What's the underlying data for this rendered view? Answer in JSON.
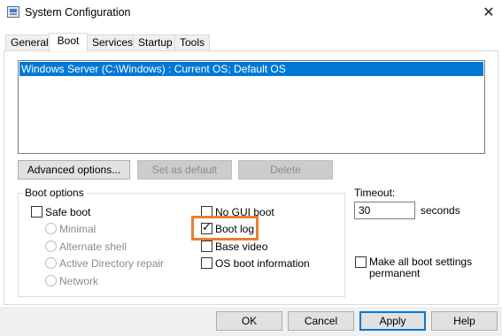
{
  "window": {
    "title": "System Configuration",
    "close_label": "✕"
  },
  "tabs": [
    {
      "label": "General",
      "active": false
    },
    {
      "label": "Boot",
      "active": true
    },
    {
      "label": "Services",
      "active": false
    },
    {
      "label": "Startup",
      "active": false
    },
    {
      "label": "Tools",
      "active": false
    }
  ],
  "os_list": {
    "items": [
      "Windows Server (C:\\Windows) : Current OS; Default OS"
    ],
    "selected_index": 0
  },
  "list_buttons": {
    "advanced": "Advanced options...",
    "set_default": "Set as default",
    "delete": "Delete"
  },
  "boot_options": {
    "group_label": "Boot options",
    "safe_boot": {
      "label": "Safe boot",
      "checked": false
    },
    "radios": {
      "minimal": "Minimal",
      "alternate_shell": "Alternate shell",
      "ad_repair": "Active Directory repair",
      "network": "Network"
    },
    "no_gui_boot": {
      "label": "No GUI boot",
      "checked": false
    },
    "boot_log": {
      "label": "Boot log",
      "checked": true
    },
    "base_video": {
      "label": "Base video",
      "checked": false
    },
    "os_boot_info": {
      "label": "OS boot information",
      "checked": false
    }
  },
  "timeout": {
    "label": "Timeout:",
    "value": "30",
    "unit": "seconds"
  },
  "make_permanent": {
    "label_line1": "Make all boot settings",
    "label_line2": "permanent",
    "checked": false
  },
  "footer_buttons": {
    "ok": "OK",
    "cancel": "Cancel",
    "apply": "Apply",
    "help": "Help"
  },
  "colors": {
    "selection": "#0078d7",
    "highlight_annotation": "#ed7d31"
  }
}
